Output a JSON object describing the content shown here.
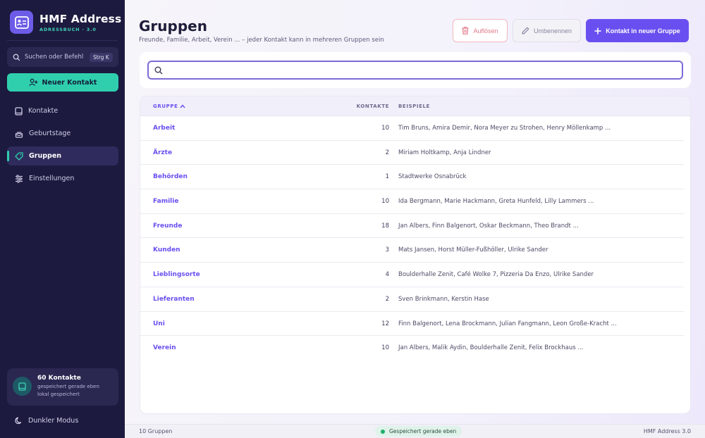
{
  "brand": {
    "title": "HMF Address",
    "subtitle": "ADRESSBUCH · 3.0"
  },
  "sidebar": {
    "search_label": "Suchen oder Befehl ...",
    "search_shortcut": "Strg K",
    "new_contact_label": "Neuer Kontakt",
    "nav": [
      {
        "label": "Kontakte",
        "icon": "book-icon"
      },
      {
        "label": "Geburtstage",
        "icon": "cake-icon"
      },
      {
        "label": "Gruppen",
        "icon": "tag-icon",
        "active": true
      },
      {
        "label": "Einstellungen",
        "icon": "sliders-icon"
      }
    ],
    "stats": {
      "title": "60 Kontakte",
      "line1": "gespeichert gerade eben",
      "line2": "lokal gespeichert"
    },
    "dark_mode_label": "Dunkler Modus"
  },
  "header": {
    "title": "Gruppen",
    "subtitle": "Freunde, Familie, Arbeit, Verein ... – jeder Kontakt kann in mehreren Gruppen sein",
    "dissolve_label": "Auflösen",
    "rename_label": "Umbenennen",
    "add_label": "Kontakt in neuer Gruppe"
  },
  "search": {
    "value": "",
    "placeholder": ""
  },
  "table": {
    "columns": {
      "group": "GRUPPE",
      "count": "KONTAKTE",
      "examples": "BEISPIELE"
    },
    "rows": [
      {
        "group": "Arbeit",
        "count": "10",
        "examples": "Tim Bruns, Amira Demir, Nora Meyer zu Strohen, Henry Möllenkamp ..."
      },
      {
        "group": "Ärzte",
        "count": "2",
        "examples": "Miriam Holtkamp, Anja Lindner"
      },
      {
        "group": "Behörden",
        "count": "1",
        "examples": "Stadtwerke Osnabrück"
      },
      {
        "group": "Familie",
        "count": "10",
        "examples": "Ida Bergmann, Marie Hackmann, Greta Hunfeld, Lilly Lammers ..."
      },
      {
        "group": "Freunde",
        "count": "18",
        "examples": "Jan Albers, Finn Balgenort, Oskar Beckmann, Theo Brandt ..."
      },
      {
        "group": "Kunden",
        "count": "3",
        "examples": "Mats Jansen, Horst Müller-Fußhöller, Ulrike Sander"
      },
      {
        "group": "Lieblingsorte",
        "count": "4",
        "examples": "Boulderhalle Zenit, Café Wolke 7, Pizzeria Da Enzo, Ulrike Sander"
      },
      {
        "group": "Lieferanten",
        "count": "2",
        "examples": "Sven Brinkmann, Kerstin Hase"
      },
      {
        "group": "Uni",
        "count": "12",
        "examples": "Finn Balgenort, Lena Brockmann, Julian Fangmann, Leon Große-Kracht ..."
      },
      {
        "group": "Verein",
        "count": "10",
        "examples": "Jan Albers, Malik Aydin, Boulderhalle Zenit, Felix Brockhaus ..."
      }
    ]
  },
  "status": {
    "left": "10 Gruppen",
    "saved": "Gespeichert gerade eben",
    "right": "HMF Address 3.0"
  },
  "colors": {
    "accent": "#6a4ff0",
    "teal": "#2fcfae",
    "sidebar": "#1c1a3f",
    "danger": "#e2798a"
  }
}
